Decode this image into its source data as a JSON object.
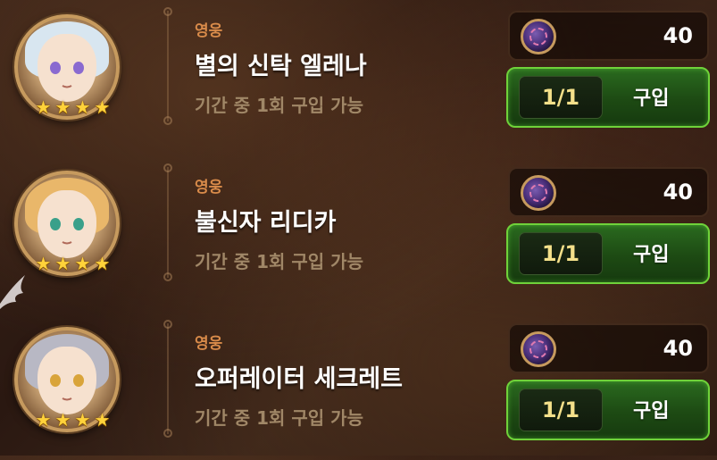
{
  "items": [
    {
      "category": "영웅",
      "name": "별의 신탁 엘레나",
      "limit": "기간 중 1회 구입 가능",
      "price": "40",
      "stock": "1/1",
      "buy_label": "구입",
      "stars": 4,
      "hair_color": "#d8e6f0",
      "eye_color": "#8a6ad0"
    },
    {
      "category": "영웅",
      "name": "불신자 리디카",
      "limit": "기간 중 1회 구입 가능",
      "price": "40",
      "stock": "1/1",
      "buy_label": "구입",
      "stars": 4,
      "hair_color": "#e9b76a",
      "eye_color": "#3aa08a"
    },
    {
      "category": "영웅",
      "name": "오퍼레이터 세크레트",
      "limit": "기간 중 1회 구입 가능",
      "price": "40",
      "stock": "1/1",
      "buy_label": "구입",
      "stars": 4,
      "hair_color": "#b8b8c4",
      "eye_color": "#d9a43a"
    }
  ],
  "colors": {
    "category": "#d98b4a",
    "limit": "#a08767",
    "stock_text": "#f4e08a",
    "button_border": "#6fd23a",
    "star": "#ffd23a"
  },
  "icons": {
    "currency": "crystal-coin-icon",
    "star": "star-icon"
  }
}
